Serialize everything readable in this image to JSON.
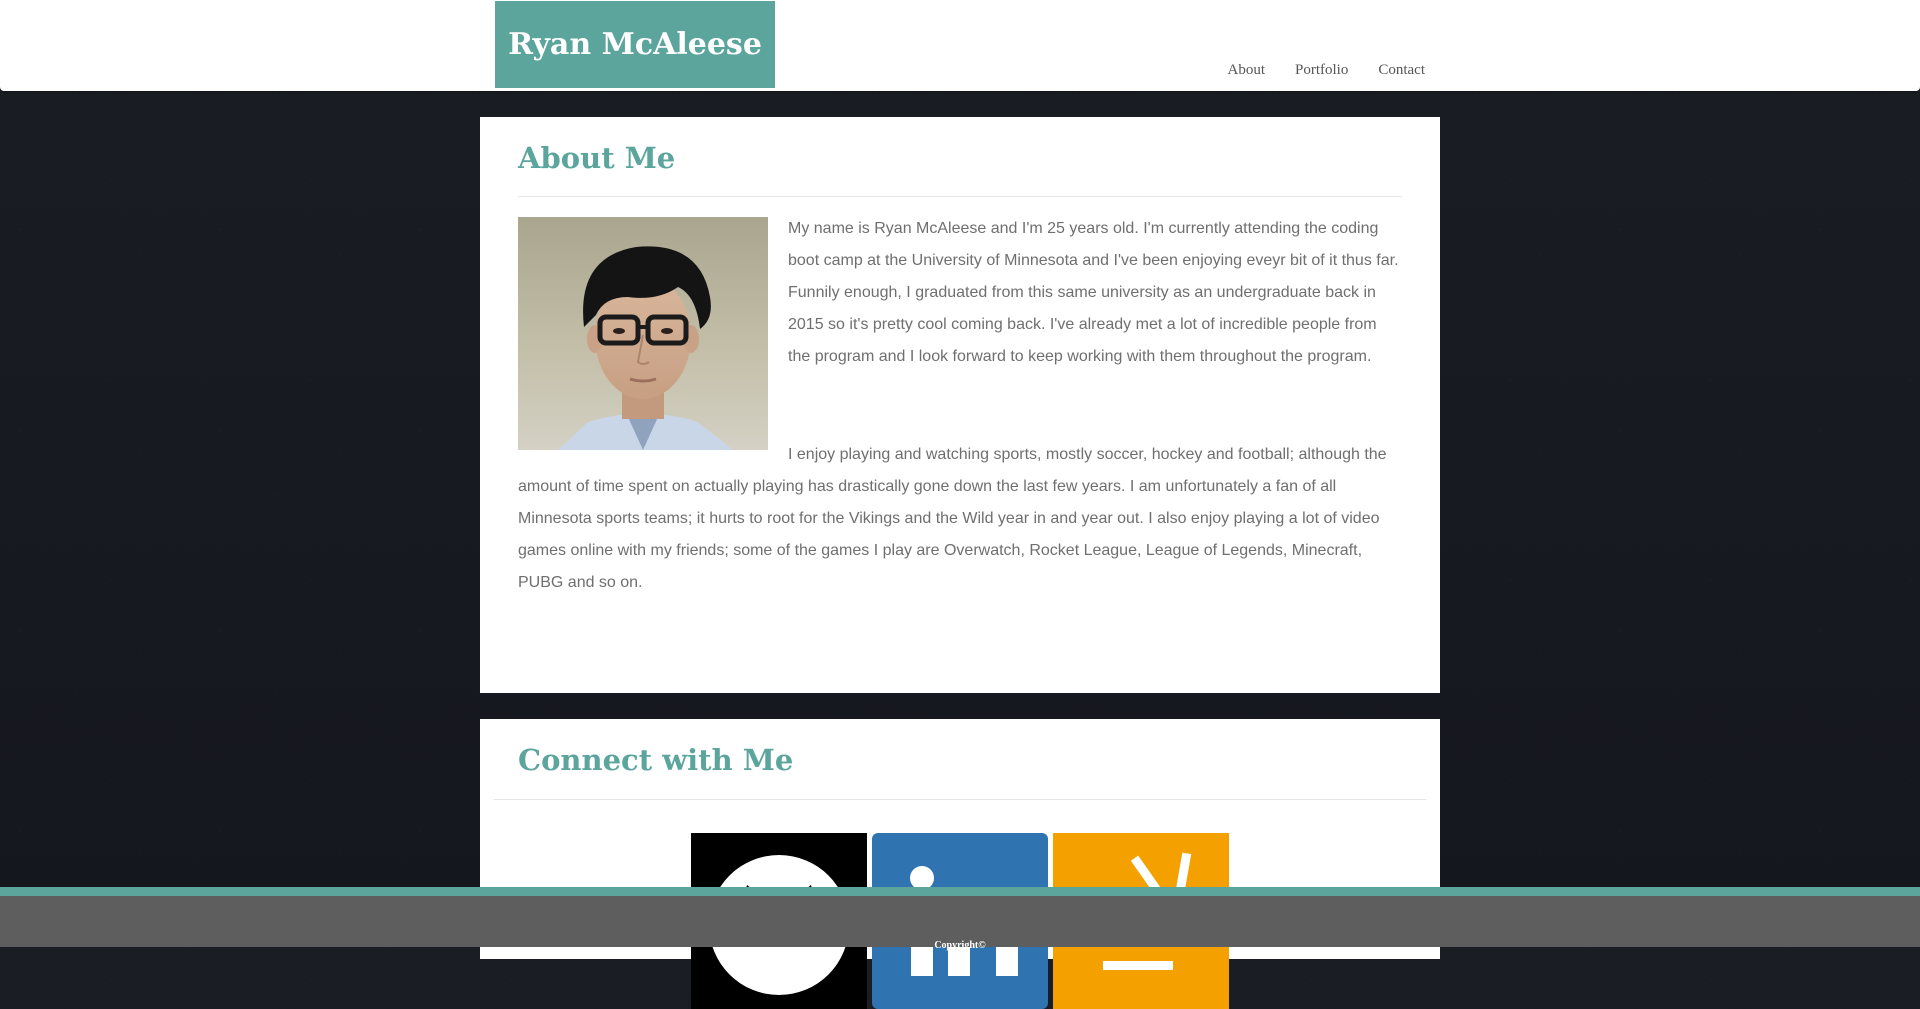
{
  "header": {
    "brand": "Ryan McAleese",
    "nav": [
      {
        "label": "About"
      },
      {
        "label": "Portfolio"
      },
      {
        "label": "Contact"
      }
    ]
  },
  "about": {
    "title": "About Me",
    "paragraph1": "My name is Ryan McAleese and I'm 25 years old. I'm currently attending the coding boot camp at the University of Minnesota and I've been enjoying eveyr bit of it thus far. Funnily enough, I graduated from this same university as an undergraduate back in 2015 so it's pretty cool coming back. I've already met a lot of incredible people from the program and I look forward to keep working with them throughout the program.",
    "paragraph2": "I enjoy playing and watching sports, mostly soccer, hockey and football; although the amount of time spent on actually playing has drastically gone down the last few years. I am unfortunately a fan of all Minnesota sports teams; it hurts to root for the Vikings and the Wild year in and year out. I also enjoy playing a lot of video games online with my friends; some of the games I play are Overwatch, Rocket League, League of Legends, Minecraft, PUBG and so on."
  },
  "connect": {
    "title": "Connect with Me",
    "links": [
      {
        "icon": "github-icon",
        "color": "#000000"
      },
      {
        "icon": "linkedin-icon",
        "color": "#2f73b0"
      },
      {
        "icon": "stackoverflow-icon",
        "color": "#f4a100"
      }
    ]
  },
  "footer": {
    "text": "Copyright©"
  },
  "colors": {
    "accent": "#5ba59d",
    "footer_bg": "#5e5e5e",
    "text_body": "#6f6f6f"
  }
}
